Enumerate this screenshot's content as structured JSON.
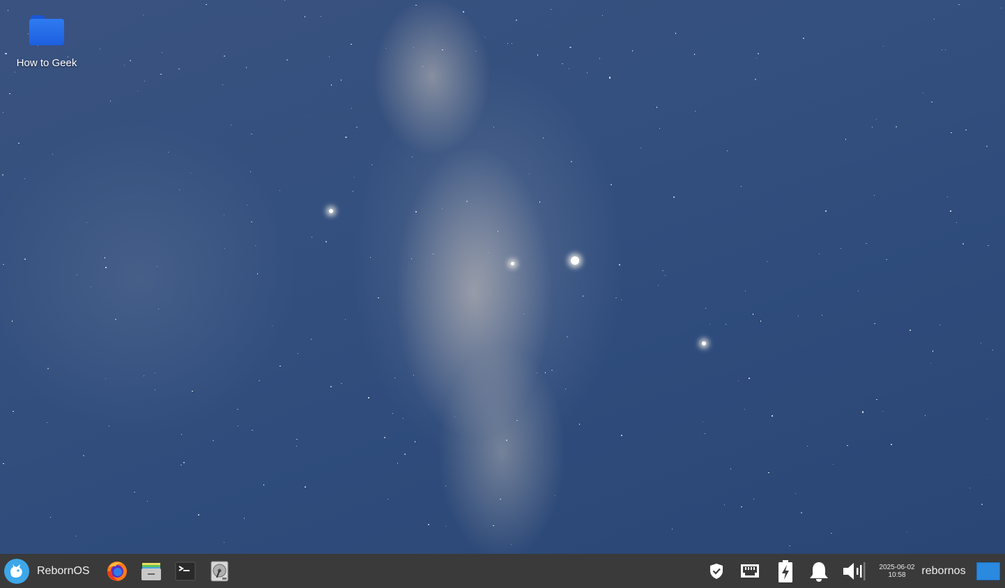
{
  "desktop": {
    "icons": [
      {
        "label": "How to Geek",
        "icon": "folder-icon",
        "color": "#2e7bf0"
      }
    ]
  },
  "taskbar": {
    "menu": {
      "label": "RebornOS",
      "icon": "rebornos-logo-icon",
      "color": "#3da7e8"
    },
    "launchers": [
      {
        "name": "firefox",
        "icon": "firefox-icon"
      },
      {
        "name": "files",
        "icon": "file-manager-icon"
      },
      {
        "name": "terminal",
        "icon": "terminal-icon"
      },
      {
        "name": "disks",
        "icon": "disk-utility-icon"
      }
    ],
    "tray": [
      {
        "name": "security",
        "icon": "shield-icon"
      },
      {
        "name": "network",
        "icon": "network-icon"
      },
      {
        "name": "power",
        "icon": "battery-charging-icon"
      },
      {
        "name": "notifications",
        "icon": "bell-icon"
      },
      {
        "name": "volume",
        "icon": "volume-icon"
      }
    ],
    "clock": {
      "date": "2025-06-02",
      "time": "10:58"
    },
    "user": "rebornos",
    "show_desktop": {
      "icon": "show-desktop-icon",
      "color": "#2a8ae0"
    }
  }
}
